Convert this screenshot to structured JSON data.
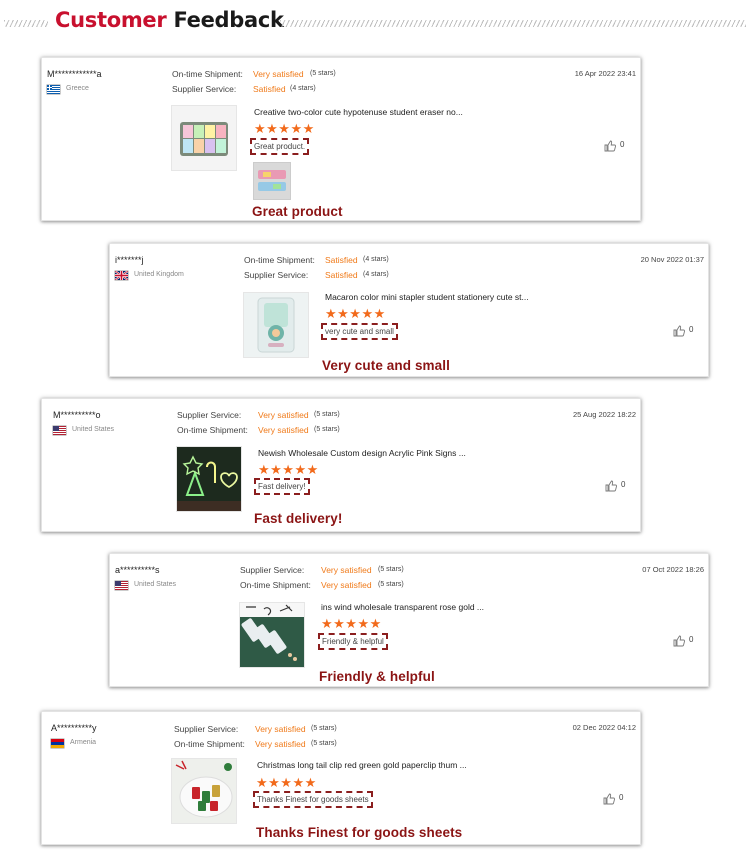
{
  "header": {
    "title_word1": "Customer",
    "title_word2": "Feedback"
  },
  "reviews": [
    {
      "user": "M************a",
      "country": "Greece",
      "flag_icon": "greece-flag-icon",
      "ratings": [
        {
          "label": "On-time Shipment:",
          "value": "Very satisfied",
          "count": "(5 stars)"
        },
        {
          "label": "Supplier Service:",
          "value": "Satisfied",
          "count": "(4 stars)"
        }
      ],
      "date": "16 Apr 2022 23:41",
      "product": "Creative two-color cute hypotenuse student eraser no...",
      "stars": 5,
      "comment": "Great product.",
      "likes": "0",
      "caption": "Great product",
      "thumb_icon": "eraser-product-thumbnail"
    },
    {
      "user": "i*******j",
      "country": "United Kingdom",
      "flag_icon": "uk-flag-icon",
      "ratings": [
        {
          "label": "On-time Shipment:",
          "value": "Satisfied",
          "count": "(4 stars)"
        },
        {
          "label": "Supplier Service:",
          "value": "Satisfied",
          "count": "(4 stars)"
        }
      ],
      "date": "20 Nov 2022 01:37",
      "product": "Macaron color mini stapler student stationery cute st...",
      "stars": 5,
      "comment": "very cute and small",
      "likes": "0",
      "caption": "Very cute and small",
      "thumb_icon": "stapler-product-thumbnail"
    },
    {
      "user": "M**********o",
      "country": "United States",
      "flag_icon": "us-flag-icon",
      "ratings": [
        {
          "label": "Supplier Service:",
          "value": "Very satisfied",
          "count": "(5 stars)"
        },
        {
          "label": "On-time Shipment:",
          "value": "Very satisfied",
          "count": "(5 stars)"
        }
      ],
      "date": "25 Aug 2022 18:22",
      "product": "Newish Wholesale Custom design Acrylic Pink Signs ...",
      "stars": 5,
      "comment": "Fast delivery!",
      "likes": "0",
      "caption": "Fast delivery!",
      "thumb_icon": "neon-sign-product-thumbnail"
    },
    {
      "user": "a**********s",
      "country": "United States",
      "flag_icon": "us-flag-icon",
      "ratings": [
        {
          "label": "Supplier Service:",
          "value": "Very satisfied",
          "count": "(5 stars)"
        },
        {
          "label": "On-time Shipment:",
          "value": "Very satisfied",
          "count": "(5 stars)"
        }
      ],
      "date": "07 Oct 2022 18:26",
      "product": "ins wind wholesale transparent rose gold ...",
      "stars": 5,
      "comment": "Friendly & helpful",
      "likes": "0",
      "caption": "Friendly & helpful",
      "thumb_icon": "pushpin-product-thumbnail"
    },
    {
      "user": "A**********y",
      "country": "Armenia",
      "flag_icon": "armenia-flag-icon",
      "ratings": [
        {
          "label": "Supplier Service:",
          "value": "Very satisfied",
          "count": "(5 stars)"
        },
        {
          "label": "On-time Shipment:",
          "value": "Very satisfied",
          "count": "(5 stars)"
        }
      ],
      "date": "02 Dec 2022 04:12",
      "product": "Christmas long tail clip red green gold paperclip thum ...",
      "stars": 5,
      "comment": "Thanks Finest for goods sheets",
      "likes": "0",
      "caption": "Thanks Finest for goods sheets",
      "thumb_icon": "paperclip-product-thumbnail"
    }
  ],
  "colors": {
    "brand_red": "#c8102e",
    "rating_orange": "#f07a1a",
    "star_orange": "#f26a1b",
    "caption_red": "#8b1414",
    "dashed_border": "#8b1e1e"
  }
}
